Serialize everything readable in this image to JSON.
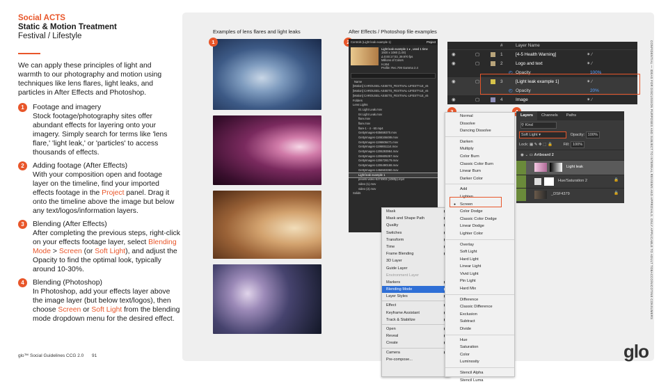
{
  "header": {
    "brand": "Social ACTS",
    "title": "Static & Motion Treatment",
    "subtitle": "Festival / Lifestyle"
  },
  "intro": "We can apply these principles of light and warmth to our photography and motion using techniques like lens flares, light leaks, and particles in After Effects and Photoshop.",
  "steps": [
    {
      "num": "1",
      "title": "Footage and imagery",
      "text": "Stock footage/photography sites offer abundant effects for layering onto your imagery. Simply search for terms like 'lens flare,' 'light leak,' or 'particles' to access thousands of effects."
    },
    {
      "num": "2",
      "title": "Adding footage (After Effects)",
      "text_a": "With your composition open and footage layer on the timeline, find your imported effects footage in the ",
      "highlight_a": "Project",
      "text_b": " panel. Drag it onto the timeline above the image but below any text/logos/information layers."
    },
    {
      "num": "3",
      "title": "Blending (After Effects)",
      "text_a": "After completing the previous steps, right-click on your effects footage layer, select ",
      "highlight_a": "Blending Mode",
      "sep": " > ",
      "highlight_b": "Screen",
      "text_b": " (or ",
      "highlight_c": "Soft Light",
      "text_c": "), and adjust the Opacity to find the optimal look, typically around 10-30%."
    },
    {
      "num": "4",
      "title": "Blending (Photoshop)",
      "text_a": "In Photoshop, add your effects layer above the image layer (but below text/logos), then choose ",
      "highlight_a": "Screen",
      "text_b": " or ",
      "highlight_b": "Soft Light",
      "text_c": " from the blending mode dropdown menu for the desired effect."
    }
  ],
  "footer": {
    "left": "glo™ Social Guidelines CCG 2.0",
    "page": "91"
  },
  "captions": {
    "examples": "Examples of lens flares and light leaks",
    "files": "After Effects / Photoshop file examples"
  },
  "badges": [
    "1",
    "2",
    "3",
    "4"
  ],
  "project_panel": {
    "tab1": "Controls (Light leak example 1)",
    "tab2": "Project",
    "info": [
      "Light leak example 1 ▾ , used 1 time",
      "1920 x 1080 (1.00)",
      "Δ 0:00:17:03, 29.970 fps",
      "Millions of Colors",
      "H.264",
      "Profile: Rec.709 Gamma 2.4"
    ],
    "name_header": "Name",
    "rows": [
      "[Motion] CAROUSEL ASSETS_FESTIVAL-LIFESTYLE_v5",
      "[Motion] CAROUSEL ASSETS_FESTIVAL-LIFESTYLE_v5",
      "[Motion] CAROUSEL ASSETS_FESTIVAL-LIFESTYLE_v5",
      "Folders",
      "Lens Lights",
      "01 Light Leak.mov",
      "04 Light Leak.mov",
      "flare.mov",
      "flare.mov",
      "flare-1 - 4 - 60.mp4",
      "GettyImages-935659370.mov",
      "GettyImages-1166166489.mov",
      "GettyImages-1196606471.mov",
      "GettyImages-1196651114.mov",
      "GettyImages-1206293984.mov",
      "GettyImages-1206605357.mov",
      "GettyImages-1206728179.mov",
      "GettyImages-1206490168.mov",
      "GettyImages-1456503360.mov",
      "Light leak example 1",
      "pexels-video-5274903 (1080p).mp4",
      "video (1).mov",
      "video (2).mov",
      "Solids"
    ]
  },
  "context_menu": {
    "items": [
      {
        "label": "Mask",
        "arrow": true
      },
      {
        "label": "Mask and Shape Path",
        "arrow": true
      },
      {
        "label": "Quality",
        "arrow": true
      },
      {
        "label": "Switches",
        "arrow": true
      },
      {
        "label": "Transform",
        "arrow": true
      },
      {
        "label": "Time",
        "arrow": true
      },
      {
        "label": "Frame Blending",
        "arrow": true
      },
      {
        "label": "3D Layer",
        "arrow": false
      },
      {
        "label": "Guide Layer",
        "arrow": false
      },
      {
        "label": "Environment Layer",
        "arrow": false,
        "disabled": true
      },
      {
        "label": "Markers",
        "arrow": true
      },
      {
        "label": "Blending Mode",
        "arrow": true,
        "selected": true
      },
      {
        "label": "Layer Styles",
        "arrow": true
      },
      {
        "sep": true
      },
      {
        "label": "Effect",
        "arrow": true
      },
      {
        "label": "Keyframe Assistant",
        "arrow": true
      },
      {
        "label": "Track & Stabilize",
        "arrow": true
      },
      {
        "sep": true
      },
      {
        "label": "Open",
        "arrow": true
      },
      {
        "label": "Reveal",
        "arrow": true
      },
      {
        "label": "Create",
        "arrow": true
      },
      {
        "sep": true
      },
      {
        "label": "Camera",
        "arrow": true
      },
      {
        "label": "Pre-compose...",
        "arrow": false
      }
    ]
  },
  "blend_menu": {
    "groups": [
      [
        "Normal",
        "Dissolve",
        "Dancing Dissolve"
      ],
      [
        "Darken",
        "Multiply",
        "Color Burn",
        "Classic Color Burn",
        "Linear Burn",
        "Darker Color"
      ],
      [
        "Add",
        "Lighten",
        "Screen",
        "Color Dodge",
        "Classic Color Dodge",
        "Linear Dodge",
        "Lighter Color"
      ],
      [
        "Overlay",
        "Soft Light",
        "Hard Light",
        "Linear Light",
        "Vivid Light",
        "Pin Light",
        "Hard Mix"
      ],
      [
        "Difference",
        "Classic Difference",
        "Exclusion",
        "Subtract",
        "Divide"
      ],
      [
        "Hue",
        "Saturation",
        "Color",
        "Luminosity"
      ],
      [
        "Stencil Alpha",
        "Stencil Luma"
      ]
    ],
    "selected": "Screen"
  },
  "ae_layers": {
    "header_num": "#",
    "header_name": "Layer Name",
    "rows": [
      {
        "num": "1",
        "name": "[4-5 Health Warning]",
        "color": "#b8a47a"
      },
      {
        "num": "2",
        "name": "Logo and text",
        "color": "#b8a47a"
      },
      {
        "sub": "Opacity",
        "value": "100%"
      },
      {
        "num": "3",
        "name": "[Light leak example 1]",
        "color": "#d6c24a"
      },
      {
        "sub": "Opacity",
        "value": "20%"
      },
      {
        "num": "4",
        "name": "Image",
        "color": "#8f8fb8"
      }
    ]
  },
  "ps_panel": {
    "tabs": [
      "Layers",
      "Channels",
      "Paths"
    ],
    "kind_label": "Kind",
    "blend_mode": "Soft Light",
    "opacity_label": "Opacity:",
    "opacity_value": "100%",
    "lock_label": "Lock:",
    "fill_label": "Fill:",
    "fill_value": "100%",
    "artboard": "Artboard 2",
    "layers": [
      "Light leak",
      "Hue/Saturation 2",
      "_DSF4379"
    ]
  },
  "confidential": "CONFIDENTIAL — IDEAS FOR DISCUSSION PURPOSES AND SUBJECT TO INTERNAL REVIEWS AND APPROVALS. ONLY APPLICABLE TO ADULT TOBACCO/NICOTINE CONSUMERS",
  "logo": "glo",
  "colors": {
    "accent": "#e8562a",
    "panel": "#efefef",
    "menu_selected": "#2f6fd6"
  }
}
